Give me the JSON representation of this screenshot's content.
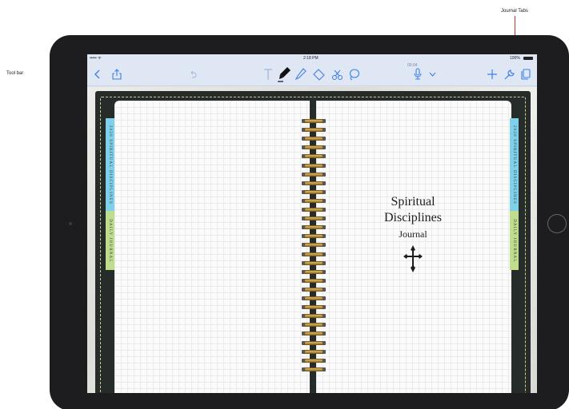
{
  "annotations": {
    "toolbar_label": "Tool bar",
    "tabs_label": "Journal Tabs"
  },
  "status_bar": {
    "signal": "••••• ᯤ",
    "time": "2:18 PM",
    "battery": "100%"
  },
  "toolbar": {
    "timer": "00:04",
    "icons": [
      "back-icon",
      "share-icon",
      "undo-icon",
      "text-icon",
      "marker-icon",
      "pen-icon",
      "highlighter-icon",
      "eraser-icon",
      "scissors-icon",
      "lasso-icon",
      "microphone-icon",
      "chevron-down-icon",
      "plus-icon",
      "wrench-icon",
      "pages-icon"
    ],
    "accent": "#3f7fe6"
  },
  "journal": {
    "left_tabs": [
      "2020 SPIRITUAL DISCIPLINES",
      "DAILY JOURNAL"
    ],
    "right_tabs": [
      "2020 SPIRITUAL DISCIPLINES",
      "DAILY JOURNAL"
    ],
    "cover_title_line1": "Spiritual",
    "cover_title_line2": "Disciplines",
    "cover_subtitle": "Journal",
    "emblem": "cross-icon",
    "tab_colors": {
      "blue": "#7fd0ea",
      "green": "#bedd8d"
    },
    "cover_color": "#262c29"
  }
}
